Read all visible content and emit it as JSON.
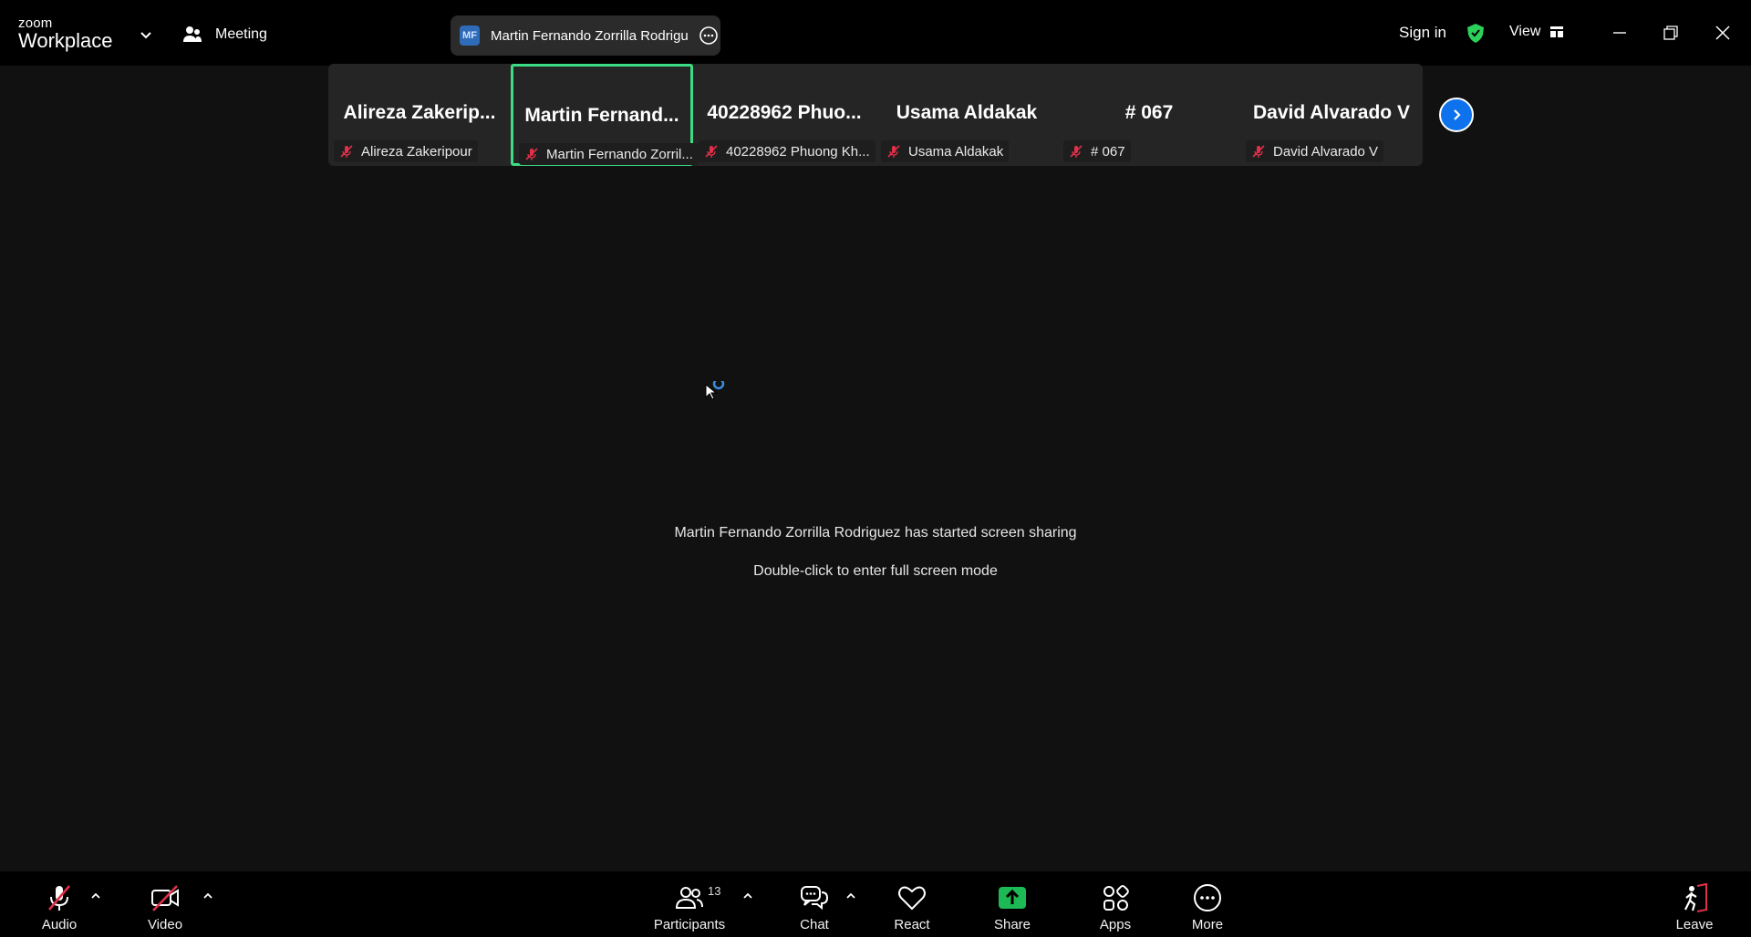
{
  "app": {
    "brand_top": "zoom",
    "brand_bottom": "Workplace"
  },
  "titlebar": {
    "meeting_label": "Meeting",
    "speaker_initials": "MF",
    "speaker_name": "Martin Fernando Zorrilla Rodrigu",
    "sign_in": "Sign in",
    "view_label": "View"
  },
  "thumbnails": [
    {
      "big": "Alireza Zakerip...",
      "tag": "Alireza Zakeripour",
      "muted": true,
      "active": false
    },
    {
      "big": "Martin Fernand...",
      "tag": "Martin Fernando Zorril...",
      "muted": true,
      "active": true
    },
    {
      "big": "40228962 Phuo...",
      "tag": "40228962 Phuong Kh...",
      "muted": true,
      "active": false
    },
    {
      "big": "Usama Aldakak",
      "tag": "Usama Aldakak",
      "muted": true,
      "active": false
    },
    {
      "big": "# 067",
      "tag": "# 067",
      "muted": true,
      "active": false
    },
    {
      "big": "David Alvarado V",
      "tag": "David Alvarado V",
      "muted": true,
      "active": false
    }
  ],
  "main": {
    "share_message": "Martin Fernando Zorrilla Rodriguez has started screen sharing",
    "hint": "Double-click to enter full screen mode"
  },
  "toolbar": {
    "audio": "Audio",
    "video": "Video",
    "participants": "Participants",
    "participants_count": "13",
    "chat": "Chat",
    "react": "React",
    "share": "Share",
    "apps": "Apps",
    "more": "More",
    "leave": "Leave"
  },
  "colors": {
    "accent_blue": "#0e72ed",
    "active_green": "#3ddc84",
    "share_green": "#1db954",
    "muted_red": "#e0304a",
    "leave_red": "#e0304a"
  }
}
